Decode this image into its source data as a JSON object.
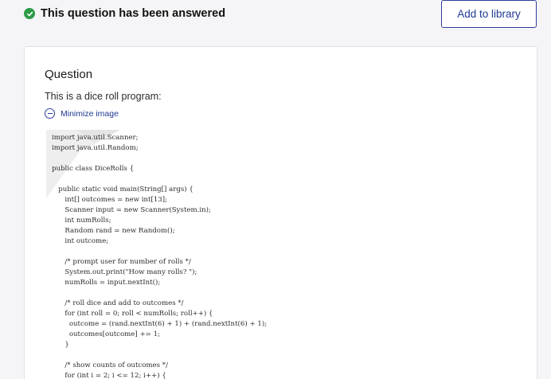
{
  "header": {
    "status_text": "This question has been answered",
    "add_button_label": "Add to library"
  },
  "question": {
    "heading": "Question",
    "text": "This is a dice roll program:",
    "minimize_label": "Minimize image"
  },
  "code_lines": [
    "import java.util.Scanner;",
    "import java.util.Random;",
    "",
    "public class DiceRolls {",
    "",
    "   public static void main(String[] args) {",
    "      int[] outcomes = new int[13];",
    "      Scanner input = new Scanner(System.in);",
    "      int numRolls;",
    "      Random rand = new Random();",
    "      int outcome;",
    "",
    "      /* prompt user for number of rolls */",
    "      System.out.print(\"How many rolls? \");",
    "      numRolls = input.nextInt();",
    "",
    "      /* roll dice and add to outcomes */",
    "      for (int roll = 0; roll < numRolls; roll++) {",
    "        outcome = (rand.nextInt(6) + 1) + (rand.nextInt(6) + 1);",
    "        outcomes[outcome] += 1;",
    "      }",
    "",
    "      /* show counts of outcomes */",
    "      for (int i = 2; i <= 12; i++) {"
  ],
  "colors": {
    "accent": "#1f3a93",
    "success": "#2e9b47",
    "background": "#f5f5f7",
    "card": "#ffffff"
  },
  "icons": {
    "status": "check-circle-icon",
    "minimize": "minus-circle-icon"
  }
}
